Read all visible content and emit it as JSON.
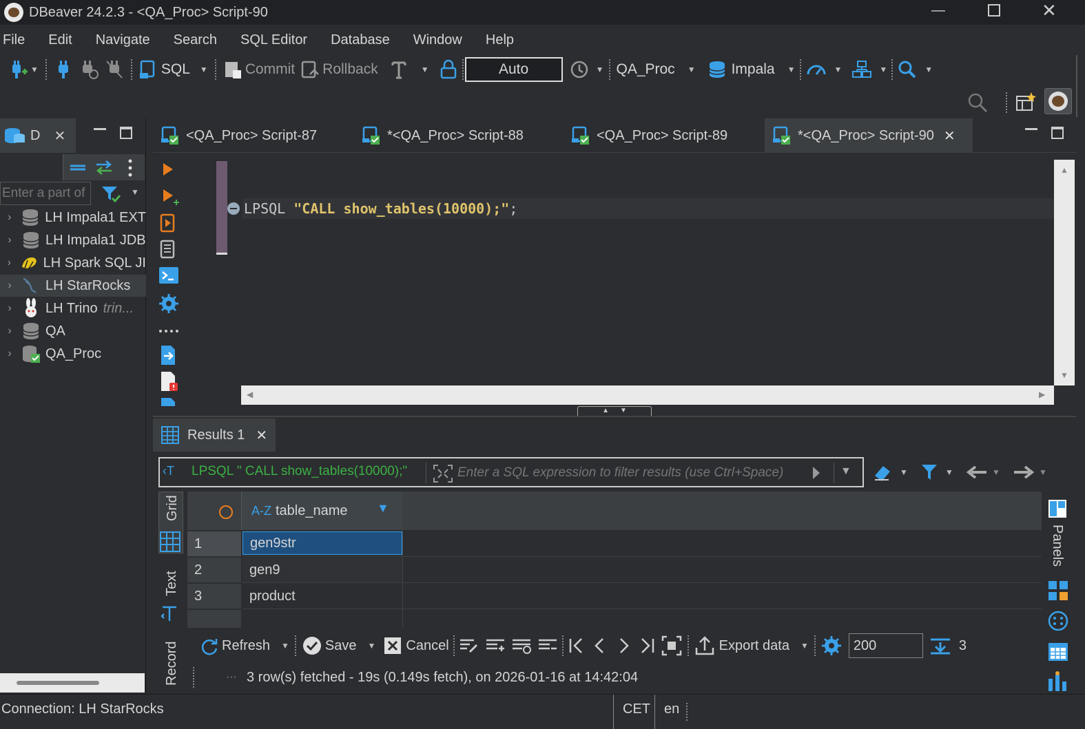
{
  "window": {
    "title": "DBeaver 24.2.3 - <QA_Proc> Script-90"
  },
  "menu": [
    "File",
    "Edit",
    "Navigate",
    "Search",
    "SQL Editor",
    "Database",
    "Window",
    "Help"
  ],
  "toolbar": {
    "sql_label": "SQL",
    "commit_label": "Commit",
    "rollback_label": "Rollback",
    "mode_value": "Auto",
    "datasource_label": "QA_Proc",
    "schema_label": "Impala"
  },
  "navigator": {
    "tab_label": "D",
    "filter_placeholder": "Enter a part of",
    "items": [
      {
        "label": "LH Impala1 EXT",
        "icon": "database-icon"
      },
      {
        "label": "LH Impala1 JDB",
        "icon": "database-icon"
      },
      {
        "label": "LH Spark SQL JI",
        "icon": "spark-icon"
      },
      {
        "label": "LH StarRocks",
        "icon": "starrocks-icon"
      },
      {
        "label": "LH Trino",
        "sublabel": "trin...",
        "icon": "trino-icon"
      },
      {
        "label": "QA",
        "icon": "database-icon"
      },
      {
        "label": "QA_Proc",
        "icon": "database-connected-icon"
      }
    ]
  },
  "editor": {
    "tabs": [
      {
        "label": "<QA_Proc> Script-87",
        "active": false
      },
      {
        "label": "*<QA_Proc> Script-88",
        "active": false
      },
      {
        "label": "<QA_Proc> Script-89",
        "active": false
      },
      {
        "label": "*<QA_Proc> Script-90",
        "active": true
      }
    ],
    "code": {
      "keyword": "LPSQL",
      "string": "\"CALL show_tables(10000);\"",
      "end": ";"
    }
  },
  "results": {
    "tab_label": "Results 1",
    "query_label": "LPSQL \" CALL show_tables(10000);\"",
    "filter_placeholder": "Enter a SQL expression to filter results (use Ctrl+Space)",
    "side_tabs": {
      "grid": "Grid",
      "text": "Text",
      "record": "Record"
    },
    "right_panel": "Panels",
    "column": {
      "type": "A-Z",
      "name": "table_name"
    },
    "rows": [
      {
        "num": "1",
        "value": "gen9str"
      },
      {
        "num": "2",
        "value": "gen9"
      },
      {
        "num": "3",
        "value": "product"
      }
    ],
    "footer": {
      "refresh": "Refresh",
      "save": "Save",
      "cancel": "Cancel",
      "export": "Export data",
      "fetch_size": "200",
      "row_count": "3",
      "status": "3 row(s) fetched - 19s (0.149s fetch), on 2026-01-16 at 14:42:04"
    }
  },
  "status": {
    "connection": "Connection: LH StarRocks",
    "timezone": "CET",
    "locale": "en"
  },
  "colors": {
    "accent": "#3aa0e8",
    "selection": "#1e4f7e",
    "string": "#e0c46c",
    "query_green": "#3cb043",
    "orange": "#e87d1e"
  }
}
